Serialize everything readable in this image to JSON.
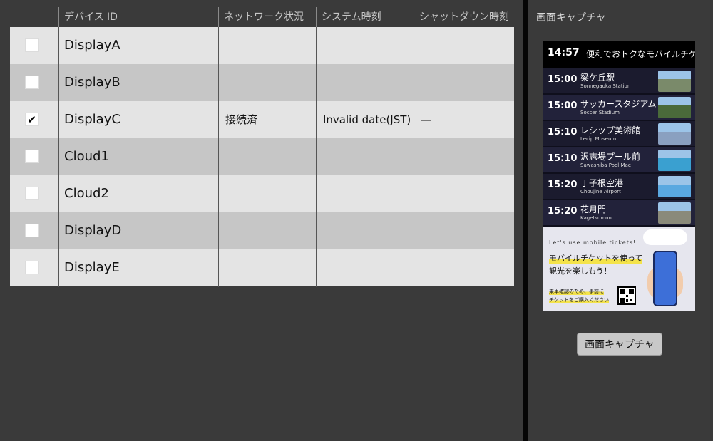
{
  "table": {
    "columns": [
      "デバイス ID",
      "ネットワーク状況",
      "システム時刻",
      "シャットダウン時刻"
    ],
    "rows": [
      {
        "checked": false,
        "device_id": "DisplayA",
        "network": "",
        "system_time": "",
        "shutdown": ""
      },
      {
        "checked": false,
        "device_id": "DisplayB",
        "network": "",
        "system_time": "",
        "shutdown": ""
      },
      {
        "checked": true,
        "device_id": "DisplayC",
        "network": "接続済",
        "system_time": "Invalid date(JST)",
        "shutdown": "—"
      },
      {
        "checked": false,
        "device_id": "Cloud1",
        "network": "",
        "system_time": "",
        "shutdown": ""
      },
      {
        "checked": false,
        "device_id": "Cloud2",
        "network": "",
        "system_time": "",
        "shutdown": ""
      },
      {
        "checked": false,
        "device_id": "DisplayD",
        "network": "",
        "system_time": "",
        "shutdown": ""
      },
      {
        "checked": false,
        "device_id": "DisplayE",
        "network": "",
        "system_time": "",
        "shutdown": ""
      }
    ],
    "checkmark": "✔"
  },
  "capture": {
    "title": "画面キャプチャ",
    "button_label": "画面キャプチャ",
    "preview": {
      "clock": "14:57",
      "marquee": "便利でおトクなモバイルチケッ",
      "departures": [
        {
          "time": "15:00",
          "jp": "梁ケ丘駅",
          "en": "Sonnegaoka Station",
          "color": "#7a8a6a"
        },
        {
          "time": "15:00",
          "jp": "サッカースタジアム",
          "en": "Soccer Stadium",
          "color": "#4a6a3a"
        },
        {
          "time": "15:10",
          "jp": "レシップ美術館",
          "en": "Lecip Museum",
          "color": "#8aa0c0"
        },
        {
          "time": "15:10",
          "jp": "沢志場プール前",
          "en": "Sawashiba Pool Mae",
          "color": "#3aa0d0"
        },
        {
          "time": "15:20",
          "jp": "丁子根空港",
          "en": "Choujine Airport",
          "color": "#5aa8e0"
        },
        {
          "time": "15:20",
          "jp": "花月門",
          "en": "Kagetsumon",
          "color": "#8a8a7a"
        }
      ],
      "ad_en": "Let's use mobile tickets!",
      "ad_line1": "モバイルチケットを使って",
      "ad_line2": "観光を楽しもう！",
      "ad_note1": "乗車確認のため、事前に",
      "ad_note2": "チケットをご購入ください"
    }
  },
  "colors": {
    "background": "#3a3a3a",
    "row_light": "#e4e4e4",
    "row_dark": "#c6c6c6",
    "divider": "#050505"
  }
}
